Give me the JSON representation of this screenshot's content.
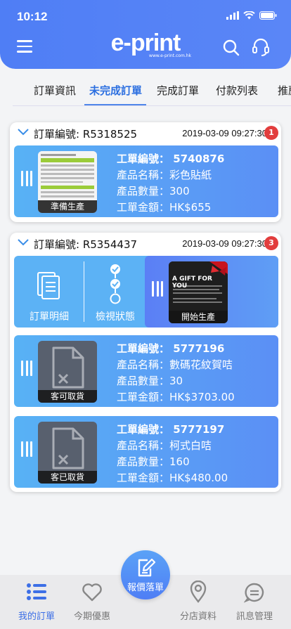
{
  "status_bar": {
    "time": "10:12"
  },
  "header": {
    "logo": "e-print",
    "logo_sub": "www.e-print.com.hk"
  },
  "tabs": [
    {
      "label": "訂單資訊"
    },
    {
      "label": "未完成訂單"
    },
    {
      "label": "完成訂單"
    },
    {
      "label": "付款列表"
    },
    {
      "label": "推薦"
    }
  ],
  "orders": [
    {
      "order_no": "訂單編號: R5318525",
      "date": "2019-03-09 09:27:30",
      "badge": "1",
      "items": [
        {
          "thumb_label": "準備生產",
          "job_no": "工單編號： 5740876",
          "product": "產品名稱：彩色貼紙",
          "qty": "產品數量：300",
          "amount": "工單金額：HK$655"
        }
      ]
    },
    {
      "order_no": "訂單編號: R5354437",
      "date": "2019-03-09 09:27:30",
      "badge": "3",
      "actions": {
        "detail": "訂單明細",
        "status": "檢視狀態",
        "production": "開始生產",
        "gift_title": "A GIFT FOR YOU"
      },
      "items": [
        {
          "thumb_label": "客可取貨",
          "job_no": "工單編號： 5777196",
          "product": "產品名稱：數碼花紋賀咭",
          "qty": "產品數量：30",
          "amount": "工單金額：HK$3703.00"
        },
        {
          "thumb_label": "客已取貨",
          "job_no": "工單編號： 5777197",
          "product": "產品名稱：柯式白咭",
          "qty": "產品數量：160",
          "amount": "工單金額：HK$480.00"
        }
      ]
    }
  ],
  "bottom_nav": {
    "my_orders": "我的訂單",
    "offers": "今期優惠",
    "quote": "報價落單",
    "stores": "分店資料",
    "messages": "訊息管理"
  },
  "colors": {
    "primary": "#4f7ef5",
    "active": "#3d6fe6",
    "badge": "#e23d3d"
  }
}
